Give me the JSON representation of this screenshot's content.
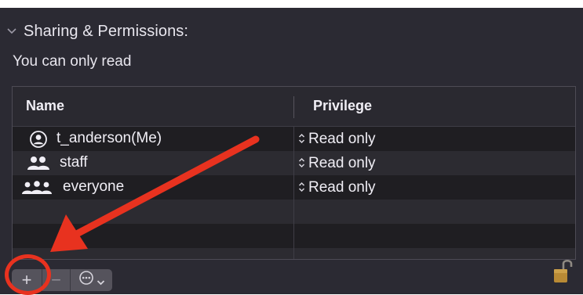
{
  "section": {
    "title": "Sharing & Permissions:",
    "chevron_icon": "chevron-down-icon"
  },
  "subtitle": "You can only read",
  "table": {
    "columns": [
      "Name",
      "Privilege"
    ],
    "rows": [
      {
        "name": "t_anderson",
        "suffix": "(Me)",
        "icon": "user-circle-icon",
        "privilege": "Read only"
      },
      {
        "name": "staff",
        "suffix": "",
        "icon": "group-icon",
        "privilege": "Read only"
      },
      {
        "name": "everyone",
        "suffix": "",
        "icon": "everyone-icon",
        "privilege": "Read only"
      }
    ]
  },
  "toolbar": {
    "add_label": "+",
    "remove_label": "−",
    "action_icon": "ellipsis-circle-icon",
    "dropdown_icon": "chevron-down-icon"
  },
  "lock_icon": "lock-open-icon",
  "colors": {
    "panel_bg": "#2b2a33",
    "row_dark": "#1f1e22",
    "row_light": "#2c2b31",
    "annotation_red": "#e8321f",
    "lock_gold": "#b98a35"
  }
}
